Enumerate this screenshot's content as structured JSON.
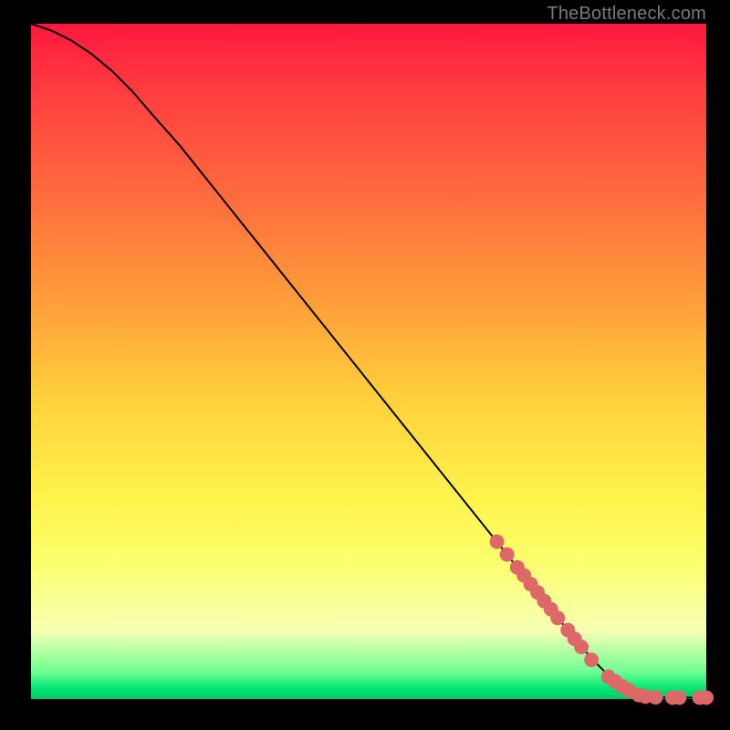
{
  "watermark": "TheBottleneck.com",
  "colors": {
    "marker": "#de6868",
    "line": "#000000"
  },
  "chart_data": {
    "type": "line",
    "title": "",
    "xlabel": "",
    "ylabel": "",
    "xlim": [
      0,
      100
    ],
    "ylim": [
      0,
      100
    ],
    "grid": false,
    "series": [
      {
        "name": "curve",
        "x": [
          0,
          3,
          6,
          9,
          12,
          15,
          18,
          22,
          30,
          40,
          50,
          60,
          70,
          78,
          83,
          86,
          88,
          90,
          92,
          94,
          96,
          98,
          100
        ],
        "y": [
          100,
          99,
          97.5,
          95.5,
          93,
          90,
          86.5,
          82,
          72,
          59.5,
          47,
          34.5,
          22,
          12,
          6,
          3,
          1.5,
          0.6,
          0.3,
          0.2,
          0.2,
          0.2,
          0.2
        ]
      }
    ],
    "markers": {
      "name": "highlighted-points",
      "x": [
        69,
        70.5,
        72,
        73,
        74,
        75,
        76,
        77,
        78,
        79.5,
        80.5,
        81.5,
        83,
        85.5,
        86.5,
        87.5,
        88.5,
        90,
        91,
        92.5,
        95,
        96,
        99,
        100
      ],
      "y": [
        23.3,
        21.4,
        19.5,
        18.3,
        17,
        15.8,
        14.5,
        13.3,
        12,
        10.2,
        8.9,
        7.7,
        5.8,
        3.3,
        2.6,
        1.9,
        1.3,
        0.6,
        0.35,
        0.25,
        0.2,
        0.2,
        0.2,
        0.2
      ]
    }
  }
}
